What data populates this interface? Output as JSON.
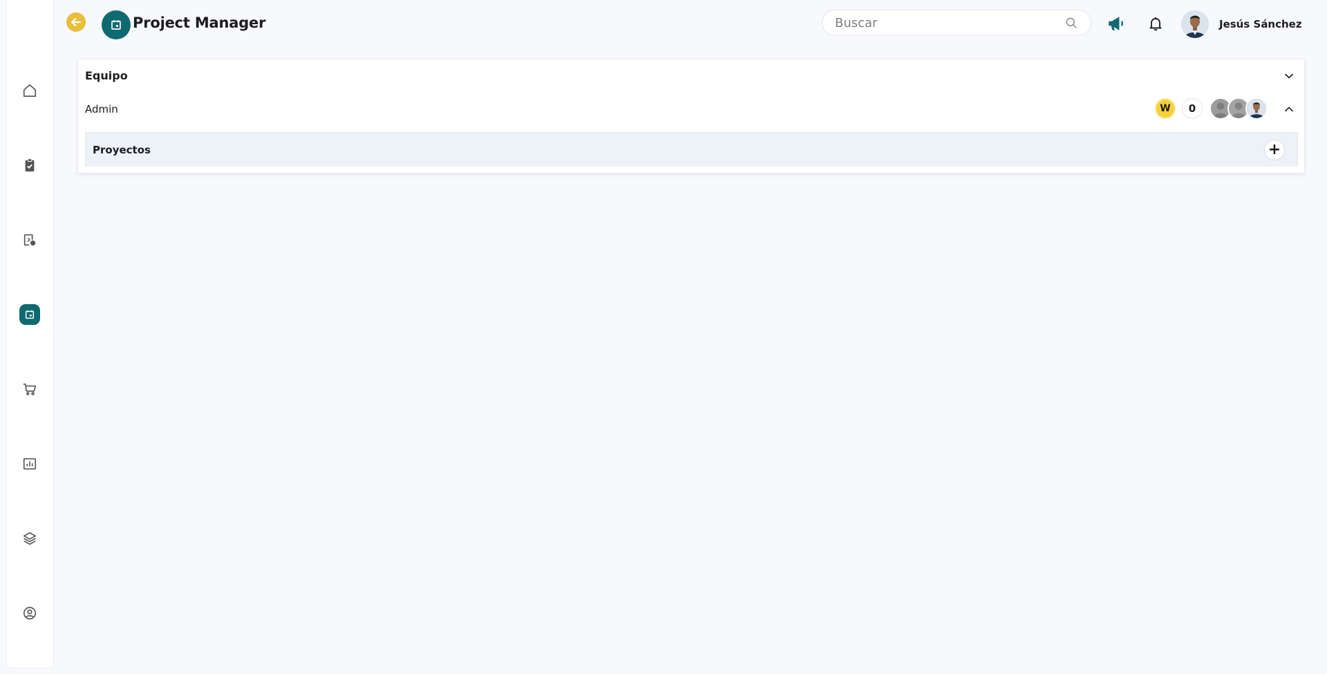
{
  "header": {
    "app_title": "Project Manager",
    "search_placeholder": "Buscar",
    "user_name": "Jesús Sánchez"
  },
  "sidebar": {
    "items": [
      {
        "icon": "home-icon"
      },
      {
        "icon": "clipboard-check-icon"
      },
      {
        "icon": "document-status-icon"
      },
      {
        "icon": "calendar-icon",
        "active": true
      },
      {
        "icon": "cart-icon"
      },
      {
        "icon": "bar-chart-icon"
      },
      {
        "icon": "layers-icon"
      },
      {
        "icon": "user-circle-icon"
      }
    ]
  },
  "panel": {
    "title": "Equipo",
    "team": {
      "name": "Admin",
      "badge": "W",
      "count": "0"
    },
    "projects_title": "Proyectos",
    "add_label": "+"
  },
  "colors": {
    "accent": "#0e6a70",
    "back_button": "#e8bf3c",
    "badge_yellow": "#f6d13a",
    "background": "#f7f9fd"
  }
}
